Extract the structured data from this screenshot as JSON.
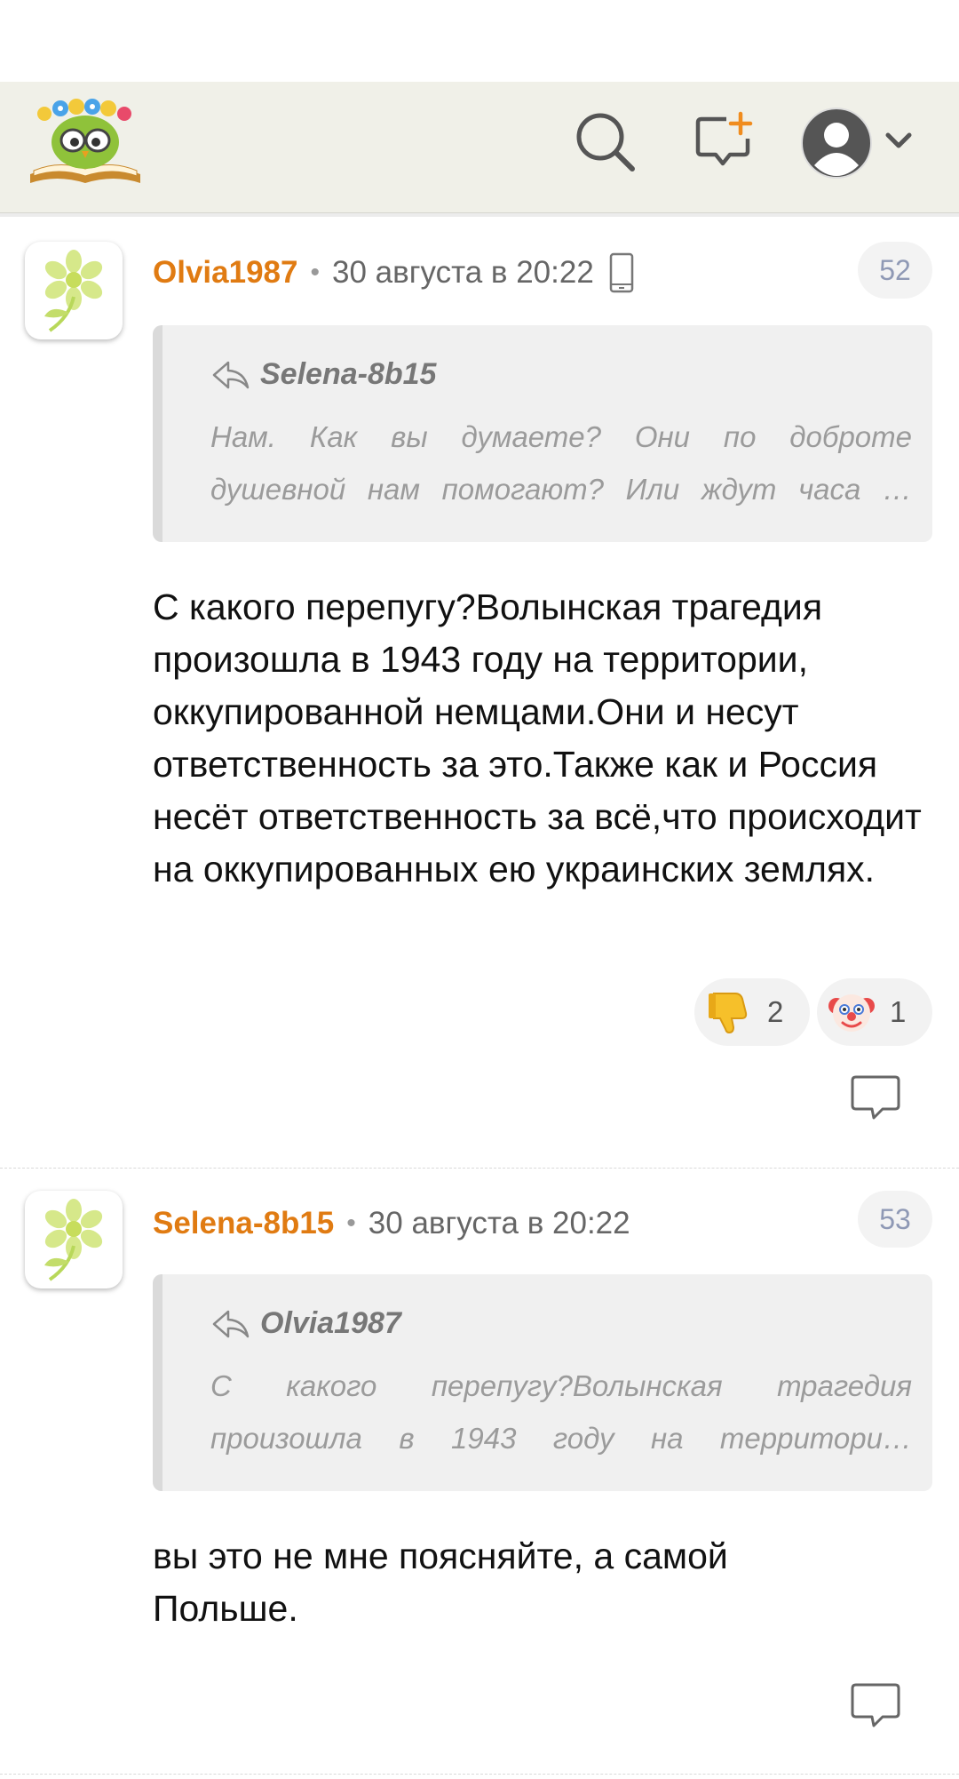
{
  "header": {
    "logo_icon": "owl-book-logo-icon",
    "search_icon": "search-icon",
    "new_message_icon": "new-message-icon",
    "profile_icon": "user-avatar-icon",
    "menu_icon": "chevron-down-icon"
  },
  "comments": [
    {
      "author": "Olvia1987",
      "separator": "•",
      "time": "30 августа в 20:22",
      "device_icon": "mobile-phone-icon",
      "number": "52",
      "quote": {
        "author": "Selena-8b15",
        "line1": "Нам. Как вы думаете? Они по доброте",
        "line2": "душевной нам помогают? Или ждут часа …"
      },
      "text": "С какого перепугу?Волынская трагедия произошла в 1943 году на территории, оккупированной немцами.Они и несут ответственность за это.Также как и Россия несёт ответственность за всё,что происходит на оккупированных ею украинских землях.",
      "reactions": [
        {
          "icon": "thumbs-down-icon",
          "count": "2"
        },
        {
          "icon": "clown-face-icon",
          "count": "1"
        }
      ]
    },
    {
      "author": "Selena-8b15",
      "separator": "•",
      "time": "30 августа в 20:22",
      "number": "53",
      "quote": {
        "author": "Olvia1987",
        "line1": "С какого перепугу?Волынская трагедия",
        "line2": "произошла в 1943 году на территори…"
      },
      "text": "вы это не мне поясняйте, а самой Польше."
    }
  ],
  "colors": {
    "author": "#e07b12",
    "header_bg": "#f0f0e8",
    "quote_bg": "#f0f0f0",
    "badge_text": "#8f99b5"
  }
}
